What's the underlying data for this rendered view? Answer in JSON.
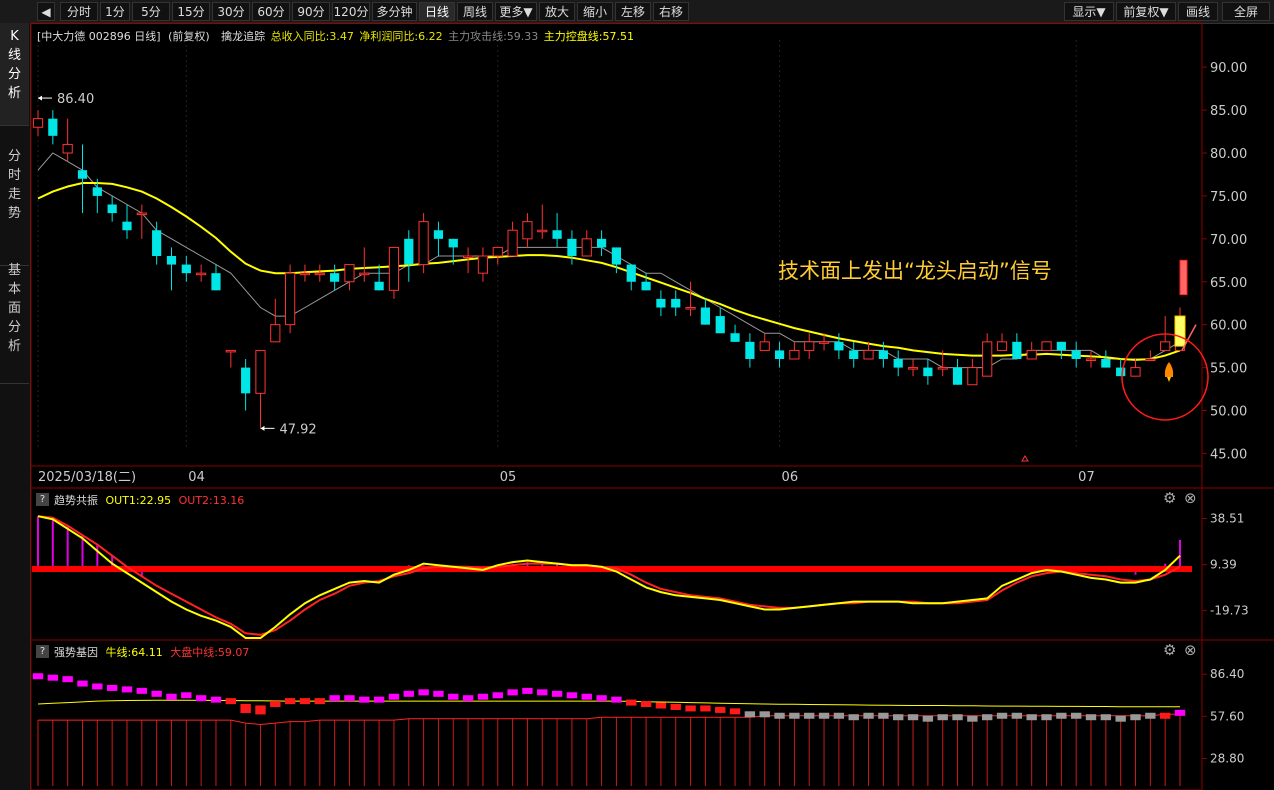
{
  "toolbar": {
    "back": "◀",
    "periods": [
      "分时",
      "1分",
      "5分",
      "15分",
      "30分",
      "60分",
      "90分",
      "120分",
      "多分钟",
      "日线",
      "周线",
      "更多▼",
      "放大",
      "缩小",
      "左移",
      "右移"
    ],
    "active_index": 9,
    "right": [
      "显示▼",
      "前复权▼",
      "画线",
      "全屏"
    ]
  },
  "sidebar": {
    "tabs": [
      "K\n线\n分\n析",
      "分\n时\n走\n势",
      "基\n本\n面\n分\n析"
    ]
  },
  "stock": {
    "name": "[中大力德 002896 日线]",
    "adj": "(前复权)"
  },
  "indicator_line": {
    "label": "擒龙追踪",
    "items": [
      {
        "text": "总收入同比:3.47",
        "color": "#e6e600"
      },
      {
        "text": "净利润同比:6.22",
        "color": "#e6e600"
      },
      {
        "text": "主力攻击线:59.33",
        "color": "#888888"
      },
      {
        "text": "主力控盘线:57.51",
        "color": "#ffff00"
      }
    ]
  },
  "chart_data": [
    {
      "type": "candlestick",
      "yticks": [
        "90.00",
        "85.00",
        "80.00",
        "75.00",
        "70.00",
        "65.00",
        "60.00",
        "55.00",
        "50.00",
        "45.00"
      ],
      "ylim": [
        44,
        92
      ],
      "x_labels": [
        {
          "text": "2025/03/18(二)",
          "index": 0
        },
        {
          "text": "04",
          "index": 10
        },
        {
          "text": "05",
          "index": 31
        },
        {
          "text": "06",
          "index": 50
        },
        {
          "text": "07",
          "index": 70
        }
      ],
      "candles": [
        [
          83,
          84,
          82,
          85
        ],
        [
          84,
          82,
          81,
          85
        ],
        [
          80,
          81,
          79,
          84
        ],
        [
          78,
          77,
          73,
          81
        ],
        [
          76,
          75,
          73,
          77
        ],
        [
          74,
          73,
          72,
          75
        ],
        [
          72,
          71,
          70,
          74
        ],
        [
          73,
          73,
          70,
          74
        ],
        [
          71,
          68,
          67,
          72
        ],
        [
          68,
          67,
          64,
          69
        ],
        [
          67,
          66,
          65,
          68
        ],
        [
          66,
          66,
          65,
          67
        ],
        [
          66,
          64,
          64,
          67
        ],
        [
          57,
          57,
          55,
          57
        ],
        [
          55,
          52,
          50,
          56
        ],
        [
          52,
          57,
          48,
          57
        ],
        [
          58,
          60,
          58,
          63
        ],
        [
          60,
          66,
          59,
          67
        ],
        [
          66,
          66,
          65,
          67
        ],
        [
          66,
          66,
          65,
          67
        ],
        [
          66,
          65,
          64,
          67
        ],
        [
          65,
          67,
          64,
          67
        ],
        [
          66,
          66,
          65,
          69
        ],
        [
          65,
          64,
          64,
          67
        ],
        [
          64,
          69,
          63,
          69
        ],
        [
          70,
          67,
          65,
          71
        ],
        [
          67,
          72,
          66,
          73
        ],
        [
          71,
          70,
          68,
          72
        ],
        [
          70,
          69,
          67,
          70
        ],
        [
          68,
          68,
          66,
          69
        ],
        [
          66,
          68,
          65,
          69
        ],
        [
          68,
          69,
          67,
          69
        ],
        [
          68,
          71,
          68,
          72
        ],
        [
          70,
          72,
          69,
          73
        ],
        [
          71,
          71,
          70,
          74
        ],
        [
          71,
          70,
          69,
          73
        ],
        [
          70,
          68,
          67,
          71
        ],
        [
          68,
          70,
          68,
          71
        ],
        [
          70,
          69,
          68,
          71
        ],
        [
          69,
          67,
          66,
          69
        ],
        [
          67,
          65,
          64,
          67
        ],
        [
          65,
          64,
          64,
          66
        ],
        [
          63,
          62,
          61,
          64
        ],
        [
          63,
          62,
          61,
          64
        ],
        [
          62,
          62,
          61,
          65
        ],
        [
          62,
          60,
          60,
          63
        ],
        [
          61,
          59,
          59,
          62
        ],
        [
          59,
          58,
          58,
          60
        ],
        [
          58,
          56,
          55,
          59
        ],
        [
          57,
          58,
          57,
          59
        ],
        [
          57,
          56,
          55,
          58
        ],
        [
          56,
          57,
          56,
          58
        ],
        [
          57,
          58,
          56,
          59
        ],
        [
          58,
          58,
          57,
          59
        ],
        [
          58,
          57,
          56,
          59
        ],
        [
          57,
          56,
          55,
          58
        ],
        [
          56,
          57,
          56,
          58
        ],
        [
          57,
          56,
          55,
          58
        ],
        [
          56,
          55,
          54,
          57
        ],
        [
          55,
          55,
          54,
          56
        ],
        [
          55,
          54,
          53,
          56
        ],
        [
          55,
          55,
          54,
          57
        ],
        [
          55,
          53,
          53,
          56
        ],
        [
          53,
          55,
          53,
          56
        ],
        [
          54,
          58,
          54,
          59
        ],
        [
          57,
          58,
          57,
          59
        ],
        [
          58,
          56,
          56,
          59
        ],
        [
          56,
          57,
          56,
          58
        ],
        [
          57,
          58,
          57,
          58
        ],
        [
          58,
          57,
          56,
          58
        ],
        [
          57,
          56,
          55,
          58
        ],
        [
          56,
          56,
          55,
          57
        ],
        [
          56,
          55,
          55,
          57
        ],
        [
          55,
          54,
          54,
          56
        ],
        [
          54,
          55,
          54,
          56
        ],
        [
          56,
          56,
          56,
          57
        ],
        [
          57,
          58,
          57,
          61
        ],
        [
          57,
          61,
          57,
          62
        ]
      ],
      "ma_fast": [
        78,
        80,
        79,
        78,
        76,
        75,
        74,
        73,
        71,
        70,
        69,
        68,
        67,
        66,
        64,
        62,
        61,
        61,
        62,
        63,
        64,
        65,
        66,
        66,
        66,
        67,
        67,
        68,
        68,
        68,
        68,
        68,
        69,
        69,
        69,
        69,
        69,
        69,
        69,
        68,
        67,
        66,
        66,
        65,
        64,
        63,
        62,
        61,
        60,
        59,
        59,
        58,
        58,
        58,
        58,
        57,
        57,
        57,
        56,
        56,
        56,
        55,
        55,
        55,
        55,
        56,
        56,
        57,
        57,
        57,
        57,
        57,
        56,
        56,
        56,
        56,
        57,
        58
      ],
      "ma_slow": [
        74.7,
        75.5,
        76.1,
        76.5,
        76.5,
        76.4,
        76.0,
        75.5,
        74.7,
        73.7,
        72.6,
        71.4,
        70.1,
        68.5,
        67.1,
        66.3,
        66.0,
        66.0,
        66.1,
        66.2,
        66.3,
        66.5,
        66.6,
        66.7,
        66.8,
        66.9,
        67.1,
        67.2,
        67.4,
        67.6,
        67.8,
        67.9,
        68.0,
        68.1,
        68.1,
        68.0,
        67.8,
        67.5,
        67.2,
        66.7,
        66.1,
        65.5,
        64.9,
        64.3,
        63.7,
        63.0,
        62.4,
        61.7,
        61.1,
        60.6,
        60.1,
        59.6,
        59.2,
        58.8,
        58.4,
        58.1,
        57.8,
        57.5,
        57.3,
        57.0,
        56.8,
        56.6,
        56.5,
        56.4,
        56.4,
        56.4,
        56.5,
        56.5,
        56.6,
        56.5,
        56.4,
        56.3,
        56.2,
        56.0,
        55.9,
        56.0,
        56.4,
        57.0
      ],
      "annotations": {
        "high_label": "86.40",
        "low_label": "47.92",
        "signal_text": "技术面上发出“龙头启动”信号",
        "rocket_icon": "rocket-icon"
      },
      "colors": {
        "up": "#ff3333",
        "down": "#00e5e5",
        "ma_slow": "#ffff00",
        "ma_fast": "#999999"
      }
    },
    {
      "type": "line",
      "title": "趋势共振",
      "legend": [
        {
          "text": "OUT1:22.95",
          "color": "#ffff00"
        },
        {
          "text": "OUT2:13.16",
          "color": "#ff3333"
        }
      ],
      "yticks": [
        "38.51",
        "9.39",
        "-19.73"
      ],
      "ylim": [
        -37,
        42
      ],
      "out1": [
        40,
        38,
        32,
        26,
        18,
        10,
        4,
        -2,
        -8,
        -14,
        -19,
        -23,
        -26,
        -30,
        -37,
        -37,
        -30,
        -22,
        -15,
        -10,
        -6,
        -2,
        -1,
        -2,
        3,
        6,
        10,
        9,
        8,
        7,
        6,
        9,
        11,
        12,
        11,
        10,
        9,
        9,
        8,
        5,
        0,
        -5,
        -8,
        -10,
        -11,
        -12,
        -13,
        -15,
        -17,
        -19,
        -19,
        -18,
        -17,
        -16,
        -15,
        -14,
        -14,
        -14,
        -14,
        -15,
        -15,
        -15,
        -14,
        -13,
        -12,
        -4,
        0,
        4,
        6,
        5,
        3,
        1,
        0,
        -2,
        -2,
        0,
        6,
        15
      ],
      "out2": [
        40,
        39,
        34,
        28,
        22,
        15,
        8,
        2,
        -4,
        -9,
        -14,
        -19,
        -24,
        -28,
        -34,
        -35,
        -32,
        -26,
        -19,
        -13,
        -9,
        -4,
        -2,
        -1,
        2,
        4,
        7,
        8,
        8,
        8,
        7,
        8,
        9,
        10,
        10,
        10,
        9,
        9,
        8,
        7,
        3,
        -2,
        -6,
        -8,
        -10,
        -11,
        -12,
        -14,
        -16,
        -17,
        -18,
        -18,
        -17,
        -16,
        -15,
        -15,
        -14,
        -14,
        -14,
        -14,
        -15,
        -15,
        -15,
        -14,
        -13,
        -7,
        -2,
        2,
        4,
        5,
        4,
        3,
        2,
        0,
        -1,
        0,
        3,
        8
      ],
      "hist": [
        40,
        39,
        34,
        28,
        22,
        15,
        8,
        2,
        0,
        0,
        0,
        0,
        0,
        0,
        0,
        0,
        0,
        0,
        0,
        0,
        0,
        0,
        0,
        0,
        8,
        9,
        9,
        8,
        7,
        7,
        7,
        9,
        10,
        11,
        11,
        10,
        9,
        8,
        7,
        5,
        0,
        0,
        0,
        0,
        0,
        0,
        0,
        0,
        0,
        0,
        0,
        0,
        0,
        0,
        0,
        0,
        0,
        0,
        0,
        0,
        0,
        0,
        0,
        0,
        0,
        0,
        0,
        0,
        0,
        0,
        0,
        0,
        0,
        0,
        3,
        5,
        10,
        25
      ]
    },
    {
      "type": "bar",
      "title": "强势基因",
      "legend": [
        {
          "text": "牛线:64.11",
          "color": "#ffff00"
        },
        {
          "text": "大盘中线:59.07",
          "color": "#ff3333"
        }
      ],
      "yticks": [
        "86.40",
        "57.60",
        "28.80"
      ],
      "ylim": [
        10,
        92
      ],
      "bars": [
        85,
        84,
        83,
        80,
        78,
        77,
        76,
        75,
        73,
        71,
        72,
        70,
        69,
        68,
        64,
        63,
        66,
        68,
        68,
        68,
        70,
        70,
        69,
        69,
        71,
        73,
        74,
        73,
        71,
        70,
        71,
        72,
        74,
        75,
        74,
        73,
        72,
        71,
        70,
        69,
        67,
        66,
        65,
        64,
        63,
        63,
        62,
        61,
        59,
        59,
        58,
        58,
        58,
        58,
        58,
        57,
        58,
        58,
        57,
        57,
        56,
        57,
        57,
        56,
        57,
        58,
        58,
        57,
        57,
        58,
        58,
        57,
        57,
        56,
        57,
        58,
        58,
        60
      ],
      "bull_line": [
        66,
        66.5,
        67,
        67.5,
        68,
        68.2,
        68.4,
        68.5,
        68.6,
        68.6,
        68.6,
        68.5,
        68.5,
        68.4,
        68.3,
        68.2,
        68.1,
        68,
        68,
        68,
        68,
        68,
        68,
        68,
        68,
        68,
        68,
        68,
        68,
        68,
        68,
        68,
        68,
        68,
        68,
        68,
        68,
        68,
        68,
        68,
        67.8,
        67.6,
        67.4,
        67.2,
        67,
        66.8,
        66.6,
        66.4,
        66.2,
        66,
        65.9,
        65.8,
        65.7,
        65.6,
        65.5,
        65.4,
        65.3,
        65.2,
        65.1,
        65,
        65,
        65,
        64.9,
        64.8,
        64.7,
        64.6,
        64.6,
        64.5,
        64.5,
        64.4,
        64.4,
        64.3,
        64.3,
        64.2,
        64.2,
        64.2,
        64.1,
        64.1
      ],
      "mid_line": [
        55,
        55,
        55,
        55,
        55,
        55,
        55,
        55,
        55,
        55,
        55,
        55,
        55,
        55,
        53,
        52,
        53,
        54,
        54,
        55,
        55,
        55,
        55,
        55,
        55,
        56,
        56,
        56,
        56,
        56,
        56,
        56,
        56,
        56,
        56,
        56,
        56,
        56,
        57,
        57,
        57,
        57,
        57,
        57,
        57,
        57,
        57,
        57,
        57,
        58,
        58,
        58,
        58,
        58,
        58,
        58,
        58,
        58,
        58,
        58,
        58,
        58,
        58,
        58,
        58,
        58,
        58,
        58,
        58,
        58,
        58,
        58,
        58,
        58,
        58,
        58,
        59,
        59
      ]
    }
  ]
}
